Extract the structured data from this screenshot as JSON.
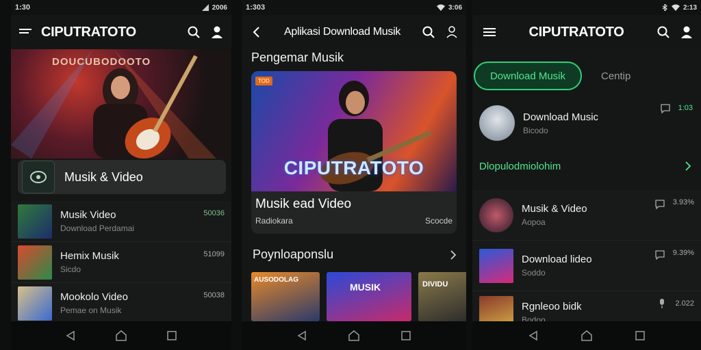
{
  "phone1": {
    "status": {
      "time": "1:30",
      "right": "2006"
    },
    "app_title": "CIPUTRATOTO",
    "hero_text": "DOUCUBODOOTO",
    "card_label": "Musik & Video",
    "list": [
      {
        "title": "Musik Video",
        "subtitle": "Download Perdamai",
        "count": "50036"
      },
      {
        "title": "Hemix Musik",
        "subtitle": "Sicdo",
        "count": "51099"
      },
      {
        "title": "Mookolo Video",
        "subtitle": "Pemae on Musik",
        "count": "50038"
      }
    ]
  },
  "phone2": {
    "status": {
      "time": "1:303",
      "right": "3:06"
    },
    "app_title": "Aplikasi Download Musik",
    "section_top": "Pengemar Musik",
    "hero_chip": "TOD",
    "hero_overlay": "CIPUTRATOTO",
    "hero_title": "Musik ead Video",
    "hero_left": "Radiokara",
    "hero_right": "Scocde",
    "section_bottom": "Poynloaponslu",
    "tiles": [
      {
        "label": "AUSODOLAG"
      },
      {
        "label": "MUSIK"
      },
      {
        "label": "DIVIDU"
      }
    ]
  },
  "phone3": {
    "status": {
      "right": "2:13"
    },
    "app_title": "CIPUTRATOTO",
    "tab_active": "Download Musik",
    "tab_inactive": "Centip",
    "top_item": {
      "title": "Download Music",
      "subtitle": "Bicodo",
      "count": "1:03"
    },
    "section_link": "Dlopulodmiolohim",
    "list": [
      {
        "title": "Musik & Video",
        "subtitle": "Aopoa",
        "count": "3.93%"
      },
      {
        "title": "Download lideo",
        "subtitle": "Soddo",
        "count": "9.39%"
      },
      {
        "title": "Rgnleoo bidk",
        "subtitle": "Bodoo",
        "count": "2.022"
      }
    ]
  },
  "colors": {
    "accent_green": "#2fd07a",
    "background": "#151716"
  },
  "icons": [
    "menu-icon",
    "search-icon",
    "profile-icon",
    "back-icon",
    "chevron-right-icon",
    "comment-icon",
    "mic-icon",
    "nav-back-icon",
    "nav-home-icon",
    "nav-recents-icon"
  ]
}
